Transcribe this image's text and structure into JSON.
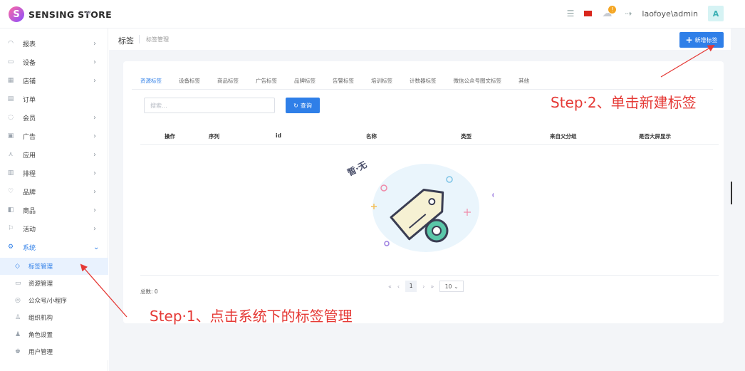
{
  "app": {
    "logo_letter": "S",
    "name": "SENSING STORE",
    "collapse_icon": "«"
  },
  "topbar": {
    "user": "laofoye\\admin",
    "avatar_letter": "A",
    "notification_count": "!"
  },
  "sidebar": {
    "items": [
      {
        "label": "报表",
        "icon": "dashboard-icon",
        "glyph": "◠"
      },
      {
        "label": "设备",
        "icon": "device-icon",
        "glyph": "▭"
      },
      {
        "label": "店铺",
        "icon": "shop-icon",
        "glyph": "▦"
      },
      {
        "label": "订单",
        "icon": "order-icon",
        "glyph": "▤"
      },
      {
        "label": "会员",
        "icon": "member-icon",
        "glyph": "◌"
      },
      {
        "label": "广告",
        "icon": "ad-icon",
        "glyph": "▣"
      },
      {
        "label": "应用",
        "icon": "app-icon",
        "glyph": "⋏"
      },
      {
        "label": "排程",
        "icon": "schedule-icon",
        "glyph": "▥"
      },
      {
        "label": "品牌",
        "icon": "brand-icon",
        "glyph": "♡"
      },
      {
        "label": "商品",
        "icon": "goods-icon",
        "glyph": "◧"
      },
      {
        "label": "活动",
        "icon": "activity-icon",
        "glyph": "⚐"
      },
      {
        "label": "系统",
        "icon": "system-icon",
        "glyph": "⚙"
      }
    ],
    "subitems": [
      {
        "label": "标签管理",
        "icon": "tag-icon",
        "glyph": "◇"
      },
      {
        "label": "资源管理",
        "icon": "resource-icon",
        "glyph": "▭"
      },
      {
        "label": "公众号/小程序",
        "icon": "wechat-icon",
        "glyph": "◎"
      },
      {
        "label": "组织机构",
        "icon": "org-icon",
        "glyph": "♙"
      },
      {
        "label": "角色设置",
        "icon": "role-icon",
        "glyph": "♟"
      },
      {
        "label": "用户管理",
        "icon": "user-icon",
        "glyph": "♚"
      }
    ]
  },
  "breadcrumb": {
    "title": "标签",
    "sub": "标签管理"
  },
  "toolbar": {
    "new_button": "新增标签"
  },
  "tabs": [
    "资源标签",
    "设备标签",
    "商品标签",
    "广告标签",
    "品牌标签",
    "告警标签",
    "培训标签",
    "计数器标签",
    "微信公众号图文标签",
    "其他"
  ],
  "search": {
    "placeholder": "搜索...",
    "query_button": "查询"
  },
  "table": {
    "columns": [
      "操作",
      "序列",
      "id",
      "名称",
      "类型",
      "来自父分组",
      "是否大屏显示"
    ],
    "empty_text": "暂·无"
  },
  "pagination": {
    "total": "总数: 0",
    "current_page": "1",
    "page_size": "10"
  },
  "annotations": {
    "step2": "Step·2、单击新建标签",
    "step1": "Step·1、点击系统下的标签管理"
  },
  "colors": {
    "primary": "#2f7fe8",
    "annotation": "#e53935"
  }
}
